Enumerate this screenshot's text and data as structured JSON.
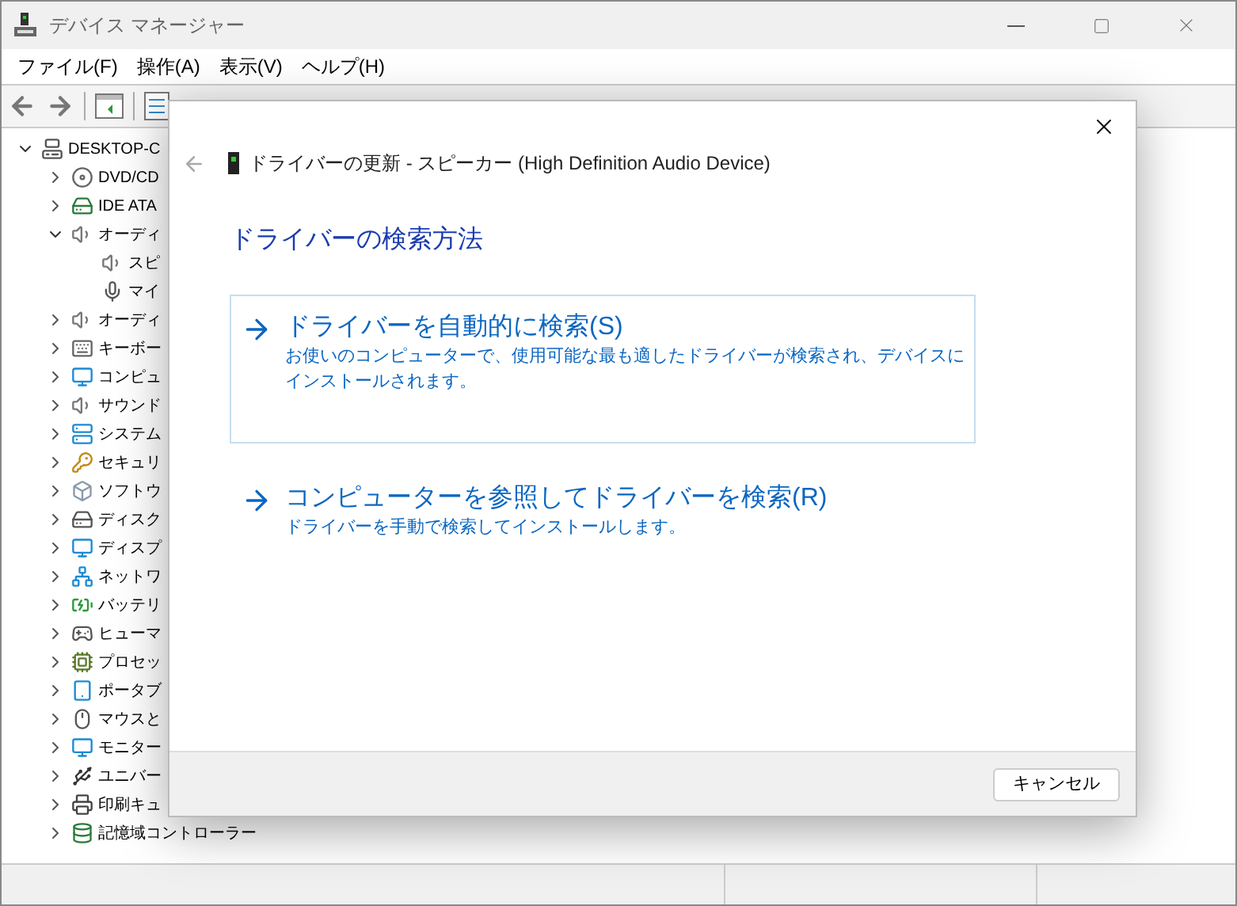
{
  "window": {
    "title": "デバイス マネージャー"
  },
  "menu": [
    "ファイル(F)",
    "操作(A)",
    "表示(V)",
    "ヘルプ(H)"
  ],
  "tree": [
    {
      "label": "DESKTOP-C",
      "expanded": true,
      "children": [
        {
          "label": "DVD/CD",
          "expanded": false
        },
        {
          "label": "IDE ATA",
          "expanded": false
        },
        {
          "label": "オーディ",
          "expanded": true,
          "children": [
            {
              "label": "スピ"
            },
            {
              "label": "マイ"
            }
          ]
        },
        {
          "label": "オーディ",
          "expanded": false
        },
        {
          "label": "キーボー",
          "expanded": false
        },
        {
          "label": "コンピュ",
          "expanded": false
        },
        {
          "label": "サウンド",
          "expanded": false
        },
        {
          "label": "システム",
          "expanded": false
        },
        {
          "label": "セキュリ",
          "expanded": false
        },
        {
          "label": "ソフトウ",
          "expanded": false
        },
        {
          "label": "ディスク",
          "expanded": false
        },
        {
          "label": "ディスプ",
          "expanded": false
        },
        {
          "label": "ネットワ",
          "expanded": false
        },
        {
          "label": "バッテリ",
          "expanded": false
        },
        {
          "label": "ヒューマ",
          "expanded": false
        },
        {
          "label": "プロセッ",
          "expanded": false
        },
        {
          "label": "ポータブ",
          "expanded": false
        },
        {
          "label": "マウスと",
          "expanded": false
        },
        {
          "label": "モニター",
          "expanded": false
        },
        {
          "label": "ユニバー",
          "expanded": false
        },
        {
          "label": "印刷キュ",
          "expanded": false
        },
        {
          "label": "記憶域コントローラー",
          "expanded": false
        }
      ]
    }
  ],
  "dialog": {
    "title": "ドライバーの更新 - スピーカー (High Definition Audio Device)",
    "heading": "ドライバーの検索方法",
    "options": [
      {
        "title": "ドライバーを自動的に検索(S)",
        "description": "お使いのコンピューターで、使用可能な最も適したドライバーが検索され、デバイスにインストールされます。",
        "selected": true
      },
      {
        "title": "コンピューターを参照してドライバーを検索(R)",
        "description": "ドライバーを手動で検索してインストールします。",
        "selected": false
      }
    ],
    "cancel": "キャンセル"
  }
}
